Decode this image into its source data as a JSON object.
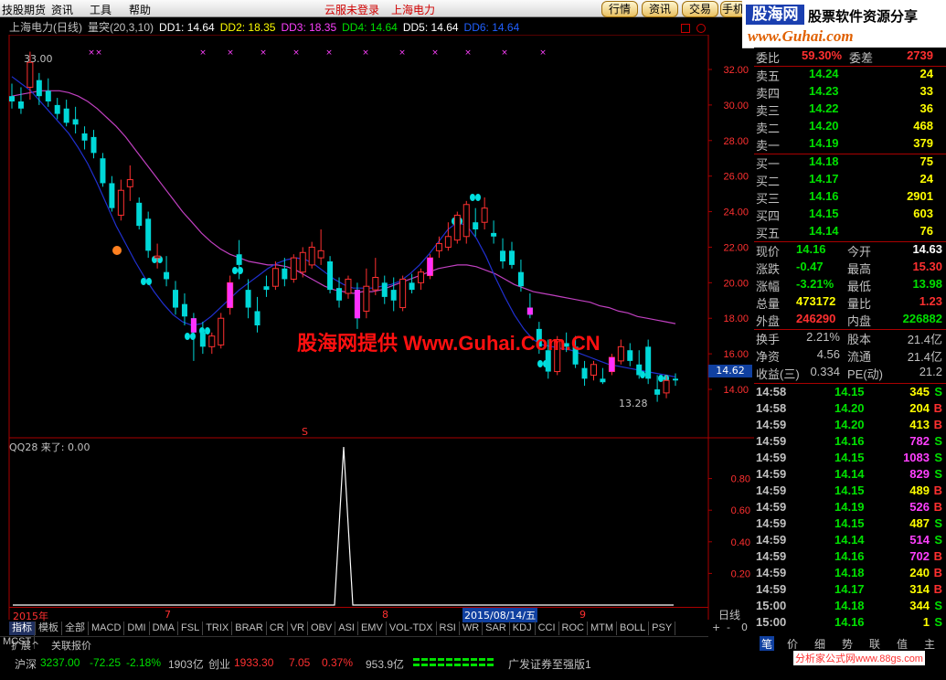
{
  "menu": {
    "items": [
      "技股期货",
      "资讯",
      "工具",
      "帮助"
    ],
    "center_items": [
      "云服未登录",
      "上海电力"
    ],
    "buttons": [
      "行情",
      "资讯",
      "交易",
      "手机"
    ]
  },
  "logo": {
    "title": "股海网",
    "slogan": "股票软件资源分享",
    "url": "www.Guhai.com"
  },
  "chart_header": {
    "name": "上海电力(日线)",
    "indicator": "量突(20,3,10)",
    "dd1": "DD1: 14.64",
    "dd2": "DD2: 18.35",
    "dd3": "DD3: 18.35",
    "dd4": "DD4: 14.64",
    "dd5": "DD5: 14.64",
    "dd6": "DD6: 14.64"
  },
  "chart_data": {
    "type": "candlestick",
    "y_ticks": [
      "32.00",
      "30.00",
      "28.00",
      "26.00",
      "24.00",
      "22.00",
      "20.00",
      "18.00",
      "16.00",
      "14.00"
    ],
    "y_range": [
      13.0,
      33.5
    ],
    "current_price_label": "14.62",
    "high_label": "33.00",
    "low_label": "13.28",
    "date_labels": [
      "2015年",
      "7",
      "8",
      "2015/08/14/五",
      "9"
    ],
    "period_label": "日线",
    "sub_title": "QQ28  来了: 0.00",
    "sub_ticks": [
      "0.80",
      "0.60",
      "0.40",
      "0.20"
    ],
    "sub_range": [
      0,
      1.0
    ],
    "sub_peak_index": 48,
    "ma_fast": [
      31.6,
      31.2,
      30.8,
      30.2,
      29.6,
      29.0,
      28.4,
      27.6,
      26.7,
      25.6,
      24.4,
      23.2,
      22.2,
      21.2,
      20.3,
      19.5,
      18.8,
      18.2,
      17.8,
      17.6,
      17.7,
      18.1,
      18.6,
      19.1,
      19.6,
      20.0,
      20.4,
      20.8,
      21.1,
      21.3,
      21.4,
      21.3,
      21.0,
      20.6,
      20.2,
      19.9,
      19.7,
      19.7,
      19.7,
      19.8,
      19.9,
      20.1,
      20.5,
      21.0,
      21.6,
      22.3,
      23.0,
      23.4,
      23.2,
      22.5,
      21.5,
      20.3,
      19.2,
      18.2,
      17.4,
      16.8,
      16.5,
      16.4,
      16.3,
      16.2,
      16.0,
      15.8,
      15.6,
      15.4,
      15.3,
      15.2,
      15.1,
      15.0,
      14.9,
      14.8,
      14.7
    ],
    "ma_slow": [
      30.5,
      30.6,
      30.7,
      30.8,
      30.8,
      30.8,
      30.7,
      30.5,
      30.2,
      29.8,
      29.3,
      28.8,
      28.2,
      27.5,
      26.8,
      26.1,
      25.4,
      24.7,
      24.0,
      23.4,
      22.8,
      22.3,
      21.9,
      21.6,
      21.4,
      21.2,
      21.1,
      21.0,
      21.0,
      20.9,
      20.7,
      20.4,
      20.1,
      19.8,
      19.6,
      19.5,
      19.4,
      19.5,
      19.5,
      19.6,
      19.8,
      20.0,
      20.2,
      20.4,
      20.6,
      20.8,
      20.9,
      21.0,
      21.0,
      20.9,
      20.7,
      20.5,
      20.2,
      19.9,
      19.7,
      19.5,
      19.4,
      19.3,
      19.2,
      19.1,
      19.0,
      18.9,
      18.7,
      18.6,
      18.4,
      18.3,
      18.1,
      18.0,
      17.9,
      17.8,
      17.7
    ],
    "candles": [
      [
        30.5,
        31.2,
        29.8,
        30.2
      ],
      [
        30.2,
        31.0,
        29.5,
        29.8
      ],
      [
        31.0,
        33.0,
        30.3,
        32.4
      ],
      [
        31.4,
        31.8,
        30.0,
        30.5
      ],
      [
        30.8,
        31.5,
        29.9,
        30.2
      ],
      [
        30.0,
        30.4,
        29.2,
        29.5
      ],
      [
        29.8,
        30.3,
        28.8,
        29.0
      ],
      [
        29.2,
        29.9,
        28.4,
        28.9
      ],
      [
        28.4,
        28.8,
        27.5,
        28.0
      ],
      [
        28.2,
        28.6,
        27.0,
        27.3
      ],
      [
        27.0,
        27.3,
        25.4,
        25.6
      ],
      [
        25.6,
        26.0,
        24.0,
        24.2
      ],
      [
        23.8,
        25.8,
        23.5,
        25.2
      ],
      [
        25.4,
        26.6,
        24.6,
        25.8
      ],
      [
        24.5,
        24.8,
        23.0,
        23.2
      ],
      [
        23.6,
        24.0,
        21.4,
        21.8
      ],
      [
        21.4,
        22.2,
        20.8,
        21.5
      ],
      [
        20.6,
        21.5,
        19.8,
        20.2
      ],
      [
        19.6,
        20.1,
        18.2,
        18.6
      ],
      [
        18.8,
        19.4,
        17.6,
        18.1
      ],
      [
        18.0,
        18.3,
        15.6,
        17.2
      ],
      [
        17.2,
        17.8,
        16.0,
        16.4
      ],
      [
        16.4,
        17.2,
        16.0,
        17.0
      ],
      [
        16.5,
        18.3,
        16.3,
        18.0
      ],
      [
        18.6,
        20.4,
        18.2,
        20.0
      ],
      [
        21.6,
        22.4,
        20.2,
        21.0
      ],
      [
        19.6,
        20.2,
        18.0,
        18.6
      ],
      [
        18.4,
        19.2,
        17.2,
        17.6
      ],
      [
        19.8,
        20.4,
        19.2,
        19.6
      ],
      [
        19.8,
        21.2,
        19.6,
        20.8
      ],
      [
        20.8,
        21.4,
        19.8,
        20.2
      ],
      [
        20.2,
        21.6,
        20.0,
        21.4
      ],
      [
        20.6,
        22.0,
        20.3,
        21.7
      ],
      [
        21.0,
        22.3,
        20.8,
        22.0
      ],
      [
        21.4,
        23.0,
        21.0,
        21.8
      ],
      [
        21.2,
        21.5,
        19.4,
        19.6
      ],
      [
        19.7,
        20.3,
        18.6,
        19.0
      ],
      [
        19.4,
        20.4,
        19.1,
        20.2
      ],
      [
        19.6,
        20.0,
        17.4,
        18.0
      ],
      [
        18.4,
        20.8,
        18.0,
        19.8
      ],
      [
        19.6,
        21.4,
        19.3,
        20.3
      ],
      [
        20.0,
        20.4,
        18.8,
        19.2
      ],
      [
        19.6,
        20.3,
        18.4,
        19.0
      ],
      [
        18.6,
        20.4,
        18.4,
        20.2
      ],
      [
        20.0,
        20.5,
        19.4,
        19.6
      ],
      [
        20.0,
        20.8,
        19.6,
        20.6
      ],
      [
        20.4,
        21.6,
        20.2,
        21.4
      ],
      [
        21.8,
        22.6,
        21.4,
        22.2
      ],
      [
        22.0,
        23.4,
        21.8,
        22.6
      ],
      [
        22.4,
        24.0,
        22.2,
        23.8
      ],
      [
        22.6,
        24.6,
        22.2,
        24.4
      ],
      [
        23.4,
        24.2,
        22.6,
        23.0
      ],
      [
        23.4,
        24.8,
        23.0,
        24.2
      ],
      [
        22.8,
        23.5,
        22.2,
        22.6
      ],
      [
        21.8,
        22.5,
        20.8,
        21.2
      ],
      [
        21.8,
        22.3,
        20.8,
        21.0
      ],
      [
        20.6,
        21.3,
        19.5,
        19.8
      ],
      [
        18.6,
        19.4,
        18.0,
        18.2
      ],
      [
        17.4,
        17.8,
        16.0,
        16.4
      ],
      [
        16.2,
        16.8,
        14.6,
        15.0
      ],
      [
        15.0,
        17.0,
        14.8,
        16.8
      ],
      [
        16.6,
        17.2,
        16.1,
        16.4
      ],
      [
        16.4,
        17.0,
        15.2,
        15.4
      ],
      [
        15.2,
        15.6,
        14.2,
        14.6
      ],
      [
        14.8,
        15.6,
        14.5,
        15.4
      ],
      [
        14.6,
        15.2,
        14.3,
        14.4
      ],
      [
        15.0,
        16.0,
        14.8,
        15.8
      ],
      [
        15.6,
        16.8,
        15.4,
        16.4
      ],
      [
        16.2,
        16.6,
        15.3,
        15.6
      ],
      [
        15.4,
        16.2,
        14.6,
        14.8
      ],
      [
        16.4,
        16.8,
        14.3,
        14.6
      ],
      [
        14.0,
        14.8,
        13.3,
        13.7
      ],
      [
        13.8,
        14.8,
        13.5,
        14.5
      ],
      [
        14.6,
        14.9,
        14.2,
        14.5
      ]
    ]
  },
  "watermark": {
    "text": "股海网提供 Www.Guhai.Com.CN"
  },
  "quote": {
    "ratio": {
      "label": "委比",
      "value": "59.30%",
      "label2": "委差",
      "value2": "2739"
    },
    "sells": [
      {
        "label": "卖五",
        "price": "14.24",
        "vol": "24"
      },
      {
        "label": "卖四",
        "price": "14.23",
        "vol": "33"
      },
      {
        "label": "卖三",
        "price": "14.22",
        "vol": "36"
      },
      {
        "label": "卖二",
        "price": "14.20",
        "vol": "468"
      },
      {
        "label": "卖一",
        "price": "14.19",
        "vol": "379"
      }
    ],
    "buys": [
      {
        "label": "买一",
        "price": "14.18",
        "vol": "75"
      },
      {
        "label": "买二",
        "price": "14.17",
        "vol": "24"
      },
      {
        "label": "买三",
        "price": "14.16",
        "vol": "2901"
      },
      {
        "label": "买四",
        "price": "14.15",
        "vol": "603"
      },
      {
        "label": "买五",
        "price": "14.14",
        "vol": "76"
      }
    ],
    "stats": [
      {
        "l1": "现价",
        "v1": "14.16",
        "c1": "#00e000",
        "l2": "今开",
        "v2": "14.63",
        "c2": "#ffffff"
      },
      {
        "l1": "涨跌",
        "v1": "-0.47",
        "c1": "#00e000",
        "l2": "最高",
        "v2": "15.30",
        "c2": "#ff3030"
      },
      {
        "l1": "涨幅",
        "v1": "-3.21%",
        "c1": "#00e000",
        "l2": "最低",
        "v2": "13.98",
        "c2": "#00e000"
      },
      {
        "l1": "总量",
        "v1": "473172",
        "c1": "#ffff00",
        "l2": "量比",
        "v2": "1.23",
        "c2": "#ff3030"
      },
      {
        "l1": "外盘",
        "v1": "246290",
        "c1": "#ff3030",
        "l2": "内盘",
        "v2": "226882",
        "c2": "#00e000"
      }
    ],
    "stats2": [
      {
        "l1": "换手",
        "v1": "2.21%",
        "l2": "股本",
        "v2": "21.4亿"
      },
      {
        "l1": "净资",
        "v1": "4.56",
        "l2": "流通",
        "v2": "21.4亿"
      },
      {
        "l1": "收益(三)",
        "v1": "0.334",
        "l2": "PE(动)",
        "v2": "21.2"
      }
    ],
    "ticks": [
      {
        "t": "14:58",
        "p": "14.15",
        "q": "345",
        "s": "S",
        "qc": "#ffff00"
      },
      {
        "t": "14:58",
        "p": "14.20",
        "q": "204",
        "s": "B",
        "qc": "#ffff00"
      },
      {
        "t": "14:59",
        "p": "14.20",
        "q": "413",
        "s": "B",
        "qc": "#ffff00"
      },
      {
        "t": "14:59",
        "p": "14.16",
        "q": "782",
        "s": "S",
        "qc": "#ff40ff"
      },
      {
        "t": "14:59",
        "p": "14.15",
        "q": "1083",
        "s": "S",
        "qc": "#ff40ff"
      },
      {
        "t": "14:59",
        "p": "14.14",
        "q": "829",
        "s": "S",
        "qc": "#ff40ff"
      },
      {
        "t": "14:59",
        "p": "14.15",
        "q": "489",
        "s": "B",
        "qc": "#ffff00"
      },
      {
        "t": "14:59",
        "p": "14.19",
        "q": "526",
        "s": "B",
        "qc": "#ff40ff"
      },
      {
        "t": "14:59",
        "p": "14.15",
        "q": "487",
        "s": "S",
        "qc": "#ffff00"
      },
      {
        "t": "14:59",
        "p": "14.14",
        "q": "514",
        "s": "S",
        "qc": "#ff40ff"
      },
      {
        "t": "14:59",
        "p": "14.16",
        "q": "702",
        "s": "B",
        "qc": "#ff40ff"
      },
      {
        "t": "14:59",
        "p": "14.18",
        "q": "240",
        "s": "B",
        "qc": "#ffff00"
      },
      {
        "t": "14:59",
        "p": "14.17",
        "q": "314",
        "s": "B",
        "qc": "#ffff00"
      },
      {
        "t": "15:00",
        "p": "14.18",
        "q": "344",
        "s": "S",
        "qc": "#ffff00"
      },
      {
        "t": "15:00",
        "p": "14.16",
        "q": "1",
        "s": "S",
        "qc": "#ffff00"
      }
    ],
    "bottom_tabs": [
      "笔",
      "价",
      "细",
      "势",
      "联",
      "值",
      "主"
    ]
  },
  "indicator_tabs": [
    "指标",
    "模板",
    "全部",
    "MACD",
    "DMI",
    "DMA",
    "FSL",
    "TRIX",
    "BRAR",
    "CR",
    "VR",
    "OBV",
    "ASI",
    "EMV",
    "VOL-TDX",
    "RSI",
    "WR",
    "SAR",
    "KDJ",
    "CCI",
    "ROC",
    "MTM",
    "BOLL",
    "PSY",
    "MCST"
  ],
  "extra_tabs": [
    "扩展^",
    "关联报价"
  ],
  "zoom_buttons": [
    "+",
    "-",
    "0"
  ],
  "status": {
    "sh_label": "沪深",
    "sh_val": "3237.00",
    "sh_chg": "-72.25",
    "sh_pct": "-2.18%",
    "sh_amt": "1903亿",
    "cy_label": "创业",
    "cy_val": "1933.30",
    "cy_chg": "7.05",
    "cy_pct": "0.37%",
    "cy_amt": "953.9亿",
    "broker": "广发证券至强版1",
    "bottom_logo": "分析家公式网www.88gs.com"
  }
}
